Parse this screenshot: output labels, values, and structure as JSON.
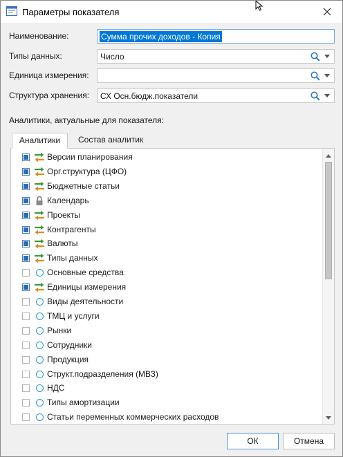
{
  "window": {
    "title": "Параметры показателя"
  },
  "fields": {
    "name": {
      "label": "Наименование:",
      "value": "Сумма прочих доходов - Копия"
    },
    "data_types": {
      "label": "Типы данных:",
      "value": "Число"
    },
    "unit": {
      "label": "Единица измерения:",
      "value": ""
    },
    "storage": {
      "label": "Структура хранения:",
      "value": "СХ Осн.бюдж.показатели"
    }
  },
  "analytics_section": {
    "label": "Аналитики, актуальные для показателя:",
    "tabs": [
      "Аналитики",
      "Состав аналитик"
    ],
    "active_tab": 0,
    "items": [
      {
        "label": "Версии планирования",
        "checked": true,
        "icon": "arrows-icon"
      },
      {
        "label": "Орг.структура (ЦФО)",
        "checked": true,
        "icon": "arrows-icon"
      },
      {
        "label": "Бюджетные статьи",
        "checked": true,
        "icon": "arrows-icon"
      },
      {
        "label": "Календарь",
        "checked": true,
        "icon": "lock-icon"
      },
      {
        "label": "Проекты",
        "checked": true,
        "icon": "arrows-icon"
      },
      {
        "label": "Контрагенты",
        "checked": true,
        "icon": "arrows-icon"
      },
      {
        "label": "Валюты",
        "checked": true,
        "icon": "arrows-icon"
      },
      {
        "label": "Типы данных",
        "checked": true,
        "icon": "arrows-icon"
      },
      {
        "label": "Основные средства",
        "checked": false,
        "icon": "circle-icon"
      },
      {
        "label": "Единицы измерения",
        "checked": true,
        "icon": "arrows-icon"
      },
      {
        "label": "Виды деятельности",
        "checked": false,
        "icon": "circle-icon"
      },
      {
        "label": "ТМЦ и услуги",
        "checked": false,
        "icon": "circle-icon"
      },
      {
        "label": "Рынки",
        "checked": false,
        "icon": "circle-icon"
      },
      {
        "label": "Сотрудники",
        "checked": false,
        "icon": "circle-icon"
      },
      {
        "label": "Продукция",
        "checked": false,
        "icon": "circle-icon"
      },
      {
        "label": "Структ.подразделения (МВЗ)",
        "checked": false,
        "icon": "circle-icon"
      },
      {
        "label": "НДС",
        "checked": false,
        "icon": "circle-icon"
      },
      {
        "label": "Типы амортизации",
        "checked": false,
        "icon": "circle-icon"
      },
      {
        "label": "Статьи переменных коммерческих расходов",
        "checked": false,
        "icon": "circle-icon"
      }
    ]
  },
  "buttons": {
    "ok": "ОК",
    "cancel": "Отмена"
  },
  "colors": {
    "accent": "#0078d7",
    "checkbox_fill": "#2b6cb0",
    "arrow_green": "#3a9a3a",
    "arrow_orange": "#e08a1e",
    "circle": "#2d9bc7"
  }
}
